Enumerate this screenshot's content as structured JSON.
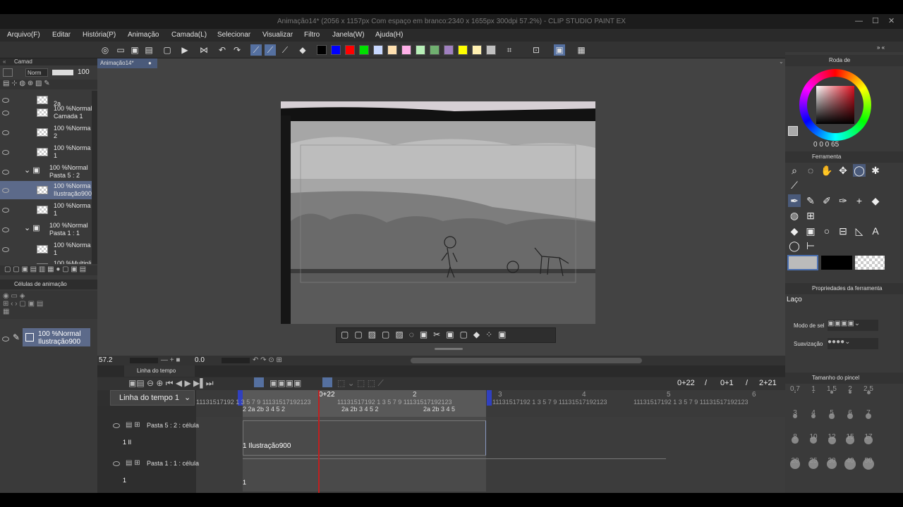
{
  "window": {
    "title": "Animação14* (2056 x 1157px Com espaço em branco:2340 x 1655px 300dpi 57.2%)  - CLIP STUDIO PAINT EX"
  },
  "menu": [
    "Arquivo(F)",
    "Editar",
    "História(P)",
    "Animação",
    "Camada(L)",
    "Selecionar",
    "Visualizar",
    "Filtro",
    "Janela(W)",
    "Ajuda(H)"
  ],
  "colors": {
    "swatches": [
      "#000000",
      "#0000ff",
      "#ff0000",
      "#00e000",
      "#c8d8ff",
      "#ffe0b0",
      "#ffb0e8",
      "#b8f0b8",
      "#70b070",
      "#a080c0",
      "#ffff00",
      "#fff0b0",
      "#c0c0c0"
    ],
    "accent": "#4a6fb0"
  },
  "canvas_tab": "Animação14*",
  "layers": {
    "panel_label": "Camad",
    "blend_mode": "Norm",
    "opacity": "100",
    "items": [
      {
        "label1": "",
        "label2": "2a"
      },
      {
        "label1": "100 %Normal",
        "label2": "Camada 1"
      },
      {
        "label1": "100 %Norma",
        "label2": "2"
      },
      {
        "label1": "100 %Norma",
        "label2": "1"
      },
      {
        "label1": "100 %Normal",
        "label2": "Pasta 5 : 2"
      },
      {
        "label1": "100 %Norma",
        "label2": "Ilustração900"
      },
      {
        "label1": "100 %Norma",
        "label2": "1"
      },
      {
        "label1": "100 %Normal",
        "label2": "Pasta 1 : 1"
      },
      {
        "label1": "100 %Norma",
        "label2": "1"
      },
      {
        "label1": "100 %Multipli",
        "label2": ""
      }
    ]
  },
  "anim_cells": {
    "title": "Células de animação",
    "item1": "100 %Normal",
    "item2": "Ilustração900"
  },
  "status": {
    "zoom": "57.2",
    "rotation": "0.0"
  },
  "timeline": {
    "tab": "Linha do tempo",
    "selector": "Linha do tempo 1",
    "frame": "0+22",
    "step": "0+1",
    "end": "2+21",
    "sep": "/",
    "marker": "0+22",
    "sec2": "2",
    "sec3": "3",
    "sec4": "4",
    "sec5": "5",
    "sec6": "6",
    "ticks": "11131517192 1 3 5 7 9 11131517192123",
    "ticks1": "2   2a 2b 3    4  5  2",
    "ticks2": "2a 2b 3    4  5  2",
    "ticks3": "2a 2b 3    4  5",
    "track1": "Pasta 5 : 2 : célula",
    "track1_cell": "1 Ilustração900",
    "track1_small": "1 Il",
    "track2": "Pasta 1 : 1 : célula",
    "track2_small": "1",
    "track2_cell": "1"
  },
  "right": {
    "color_wheel_label": "Roda de",
    "hsv": "0  0   0  65",
    "tool_label": "Ferramenta",
    "props_label": "Propriedades da ferramenta",
    "lasso": "Laço",
    "mode_label": "Modo de sel",
    "smooth_label": "Suavização",
    "brush_label": "Tamanho do pincel",
    "sizes": [
      "0.7",
      "1",
      "1.5",
      "2",
      "2.5",
      "3",
      "4",
      "5",
      "6",
      "7",
      "8",
      "10",
      "12",
      "15",
      "17",
      "20",
      "25",
      "30",
      "40",
      "50"
    ]
  }
}
